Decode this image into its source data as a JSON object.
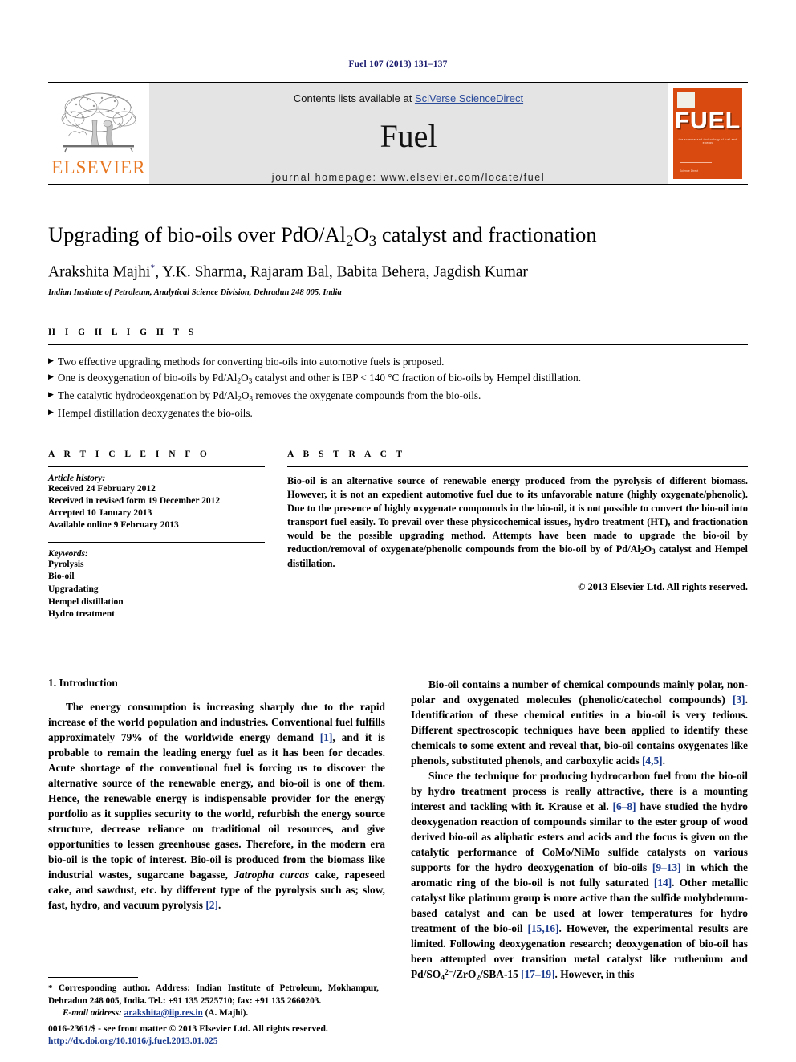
{
  "running_head": "Fuel 107 (2013) 131–137",
  "masthead": {
    "publisher_logo_name": "ELSEVIER",
    "contents_prefix": "Contents lists available at ",
    "contents_link": "SciVerse ScienceDirect",
    "journal_name": "Fuel",
    "homepage": "journal homepage: www.elsevier.com/locate/fuel",
    "cover": {
      "title": "FUEL",
      "subtitle": "the science and technology of fuel and energy",
      "bottom_text": "Science Direct"
    }
  },
  "article": {
    "title_parts": {
      "before": "Upgrading of bio-oils over PdO/Al",
      "sub1": "2",
      "mid": "O",
      "sub2": "3",
      "after": " catalyst and fractionation"
    },
    "title_plain": "Upgrading of bio-oils over PdO/Al2O3 catalyst and fractionation",
    "authors": "Arakshita Majhi",
    "authors_rest": ", Y.K. Sharma, Rajaram Bal, Babita Behera, Jagdish Kumar",
    "corresponding_marker": "*",
    "affiliation": "Indian Institute of Petroleum, Analytical Science Division, Dehradun 248 005, India"
  },
  "highlights": {
    "heading": "H I G H L I G H T S",
    "bullet_glyph": "▶",
    "items": [
      "Two effective upgrading methods for converting bio-oils into automotive fuels is proposed.",
      "One is deoxygenation of bio-oils by Pd/Al2O3 catalyst and other is IBP < 140 °C fraction of bio-oils by Hempel distillation.",
      "The catalytic hydrodeoxgenation by Pd/Al2O3 removes the oxygenate compounds from the bio-oils.",
      "Hempel distillation deoxygenates the bio-oils."
    ],
    "items_html": [
      "Two effective upgrading methods for converting bio-oils into automotive fuels is proposed.",
      "One is deoxygenation of bio-oils by Pd/Al<sub>2</sub>O<sub>3</sub> catalyst and other is IBP &lt; 140 °C fraction of bio-oils by Hempel distillation.",
      "The catalytic hydrodeoxgenation by Pd/Al<sub>2</sub>O<sub>3</sub> removes the oxygenate compounds from the bio-oils.",
      "Hempel distillation deoxygenates the bio-oils."
    ]
  },
  "article_info": {
    "heading": "A R T I C L E    I N F O",
    "history_label": "Article history:",
    "history": [
      "Received 24 February 2012",
      "Received in revised form 19 December 2012",
      "Accepted 10 January 2013",
      "Available online 9 February 2013"
    ],
    "keywords_label": "Keywords:",
    "keywords": [
      "Pyrolysis",
      "Bio-oil",
      "Upgradating",
      "Hempel distillation",
      "Hydro treatment"
    ]
  },
  "abstract": {
    "heading": "A B S T R A C T",
    "text": "Bio-oil is an alternative source of renewable energy produced from the pyrolysis of different biomass. However, it is not an expedient automotive fuel due to its unfavorable nature (highly oxygenate/phenolic). Due to the presence of highly oxygenate compounds in the bio-oil, it is not possible to convert the bio-oil into transport fuel easily. To prevail over these physicochemical issues, hydro treatment (HT), and fractionation would be the possible upgrading method. Attempts have been made to upgrade the bio-oil by reduction/removal of oxygenate/phenolic compounds from the bio-oil by of Pd/Al2O3 catalyst and Hempel distillation.",
    "text_html": "Bio-oil is an alternative source of renewable energy produced from the pyrolysis of different biomass. However, it is not an expedient automotive fuel due to its unfavorable nature (highly oxygenate/phenolic). Due to the presence of highly oxygenate compounds in the bio-oil, it is not possible to convert the bio-oil into transport fuel easily. To prevail over these physicochemical issues, hydro treatment (HT), and fractionation would be the possible upgrading method. Attempts have been made to upgrade the bio-oil by reduction/removal of oxygenate/phenolic compounds from the bio-oil by of Pd/Al<sub>2</sub>O<sub>3</sub> catalyst and Hempel distillation.",
    "copyright": "© 2013 Elsevier Ltd. All rights reserved."
  },
  "body": {
    "section_title": "1. Introduction",
    "left_paragraphs_html": [
      "The energy consumption is increasing sharply due to the rapid increase of the world population and industries. Conventional fuel fulfills approximately 79% of the worldwide energy demand <span class=\"cite\">[1]</span>, and it is probable to remain the leading energy fuel as it has been for decades. Acute shortage of the conventional fuel is forcing us to discover the alternative source of the renewable energy, and bio-oil is one of them. Hence, the renewable energy is indispensable provider for the energy portfolio as it supplies security to the world, refurbish the energy source structure, decrease reliance on traditional oil resources, and give opportunities to lessen greenhouse gases. Therefore, in the modern era bio-oil is the topic of interest. Bio-oil is produced from the biomass like industrial wastes, sugarcane bagasse, <span class=\"ital\">Jatropha curcas</span> cake, rapeseed cake, and sawdust, etc. by different type of the pyrolysis such as; slow, fast, hydro, and vacuum pyrolysis <span class=\"cite\">[2]</span>."
    ],
    "right_paragraphs_html": [
      "Bio-oil contains a number of chemical compounds mainly polar, non-polar and oxygenated molecules (phenolic/catechol compounds) <span class=\"cite\">[3]</span>. Identification of these chemical entities in a bio-oil is very tedious. Different spectroscopic techniques have been applied to identify these chemicals to some extent and reveal that, bio-oil contains oxygenates like phenols, substituted phenols, and carboxylic acids <span class=\"cite\">[4,5]</span>.",
      "Since the technique for producing hydrocarbon fuel from the bio-oil by hydro treatment process is really attractive, there is a mounting interest and tackling with it. Krause et al. <span class=\"cite\">[6–8]</span> have studied the hydro deoxygenation reaction of compounds similar to the ester group of wood derived bio-oil as aliphatic esters and acids and the focus is given on the catalytic performance of CoMo/NiMo sulfide catalysts on various supports for the hydro deoxygenation of bio-oils <span class=\"cite\">[9–13]</span> in which the aromatic ring of the bio-oil is not fully saturated <span class=\"cite\">[14]</span>. Other metallic catalyst like platinum group is more active than the sulfide molybdenum-based catalyst and can be used at lower temperatures for hydro treatment of the bio-oil <span class=\"cite\">[15,16]</span>. However, the experimental results are limited. Following deoxygenation research; deoxygenation of bio-oil has been attempted over transition metal catalyst like ruthenium and Pd/SO<sub>4</sub><sup>2−</sup>/ZrO<sub>2</sub>/SBA-15 <span class=\"cite\">[17–19]</span>. However, in this"
    ]
  },
  "footnote": {
    "html": "<span class=\"star\">*</span> Corresponding author. Address: Indian Institute of Petroleum, Mokhampur, Dehradun 248 005, India. Tel.: +91 135 2525710; fax: +91 135 2660203.",
    "email_label": "E-mail address:",
    "email": "arakshita@iip.res.in",
    "email_owner": "(A. Majhi)."
  },
  "imprint": {
    "line1": "0016-2361/$ - see front matter © 2013 Elsevier Ltd. All rights reserved.",
    "doi": "http://dx.doi.org/10.1016/j.fuel.2013.01.025"
  },
  "colors": {
    "link_blue": "#2b4b9b",
    "cite_blue": "#1a3a8f",
    "elsevier_orange": "#E87722",
    "cover_orange": "#d84a10",
    "running_head_navy": "#1a1a6e"
  }
}
